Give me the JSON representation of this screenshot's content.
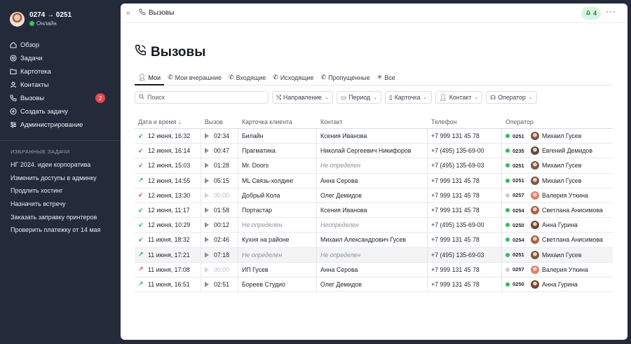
{
  "user": {
    "name": "0274 → 0251",
    "status": "Онлайн"
  },
  "nav": [
    {
      "label": "Обзор",
      "icon": "home-icon"
    },
    {
      "label": "Задачи",
      "icon": "target-icon"
    },
    {
      "label": "Картотека",
      "icon": "folder-icon"
    },
    {
      "label": "Контакты",
      "icon": "person-icon"
    },
    {
      "label": "Вызовы",
      "icon": "phone-icon",
      "badge": "2"
    },
    {
      "label": "Создать задачу",
      "icon": "plus-circle-icon"
    },
    {
      "label": "Администрирование",
      "icon": "sliders-icon"
    }
  ],
  "favorites": {
    "title": "ИЗБРАННЫЕ ЗАДАЧИ",
    "items": [
      "НГ 2024. идеи корпоратива",
      "Изменить доступы в админку",
      "Продлить хостинг",
      "Назначить встречу",
      "Заказать заправку принтеров",
      "Проверить платежку от 14 мая"
    ]
  },
  "topbar": {
    "collapse": "«",
    "title": "Вызовы",
    "notifications": "4",
    "more": "···"
  },
  "page": {
    "title": "Вызовы"
  },
  "tabs": [
    "Мои",
    "Мои вчерашние",
    "Входящие",
    "Исходящие",
    "Пропущенные",
    "Все"
  ],
  "search": {
    "placeholder": "Поиск"
  },
  "filters": [
    "Направление",
    "Период",
    "Карточка",
    "Контакт",
    "Оператор"
  ],
  "columns": [
    "Дата и время ↓",
    "Вызов",
    "Карточка клиента",
    "Контакт",
    "Телефон",
    "Оператор"
  ],
  "colors": {
    "accent": "#151a22",
    "online": "#34c759",
    "missed": "#e5484d",
    "incoming": "#2fa85a"
  },
  "rows": [
    {
      "dir": "↙",
      "type": "in",
      "date": "12 июня, 16:32",
      "dur": "02:34",
      "card": "Билайн",
      "contact": "Ксения Иванова",
      "phone": "+7 999 131 45 78",
      "op_status": "#2fbf5a",
      "ext": "0251",
      "op_color": "#7a5a48",
      "op": "Михаил Гусев"
    },
    {
      "dir": "↙",
      "type": "in",
      "date": "12 июня, 16:14",
      "dur": "00:47",
      "card": "Прагматика",
      "contact": "Николай Сергеевич Никифоров",
      "phone": "+7 (495) 135-69-00",
      "op_status": "#2fbf5a",
      "ext": "0235",
      "op_color": "#5a4a42",
      "op": "Евгений Демидов"
    },
    {
      "dir": "↙",
      "type": "in",
      "date": "12 июня, 15:03",
      "dur": "01:28",
      "card": "Mr. Doors",
      "contact": "Не определен",
      "contact_muted": true,
      "phone": "+7 (495) 135-69-03",
      "op_status": "#2fbf5a",
      "ext": "0251",
      "op_color": "#7a5a48",
      "op": "Михаил Гусев"
    },
    {
      "dir": "↗",
      "type": "out",
      "date": "12 июня, 14:55",
      "dur": "05:15",
      "card": "ML Связь-холдинг",
      "contact": "Анна Серова",
      "phone": "+7 999 131 45 78",
      "op_status": "#2fbf5a",
      "ext": "0251",
      "op_color": "#7a5a48",
      "op": "Михаил Гусев"
    },
    {
      "dir": "↙",
      "type": "missed",
      "date": "12 июня, 13:30",
      "dur": "00:00",
      "dur_muted": true,
      "card": "Добрый Кола",
      "contact": "Олег Демидов",
      "phone": "+7 999 131 45 78",
      "op_status": "#c9cdd3",
      "ext": "0257",
      "op_color": "#d9826e",
      "op": "Валерия Уткина"
    },
    {
      "dir": "↙",
      "type": "in",
      "date": "12 июня, 11:17",
      "dur": "01:58",
      "card": "Портастар",
      "contact": "Ксения Иванова",
      "phone": "+7 999 131 45 78",
      "op_status": "#2fbf5a",
      "ext": "0254",
      "op_color": "#a7614c",
      "op": "Светлана Анисимова"
    },
    {
      "dir": "↙",
      "type": "in",
      "date": "12 июня, 10:29",
      "dur": "00:12",
      "card": "Не определен",
      "card_muted": true,
      "contact": "Неопределен",
      "contact_muted": true,
      "phone": "+7 (495) 135-69-00",
      "op_status": "#2fbf5a",
      "ext": "0250",
      "op_color": "#6a4636",
      "op": "Анна Гурина"
    },
    {
      "dir": "↙",
      "type": "in",
      "date": "11 июня, 18:32",
      "dur": "02:46",
      "card": "Кухня на районе",
      "contact": "Михаил Александрович Гусев",
      "phone": "+7 999 131 45 78",
      "op_status": "#2fbf5a",
      "ext": "0254",
      "op_color": "#a7614c",
      "op": "Светлана Анисимова"
    },
    {
      "dir": "↗",
      "type": "out",
      "date": "11 июня, 17:21",
      "dur": "07:18",
      "card": "Не определен",
      "card_muted": true,
      "contact": "Не определен",
      "contact_muted": true,
      "phone": "+7 (495) 135-69-03",
      "op_status": "#2fbf5a",
      "ext": "0251",
      "op_color": "#7a5a48",
      "op": "Михаил Гусев",
      "highlight": true
    },
    {
      "dir": "↗",
      "type": "missed",
      "date": "11 июня, 17:08",
      "dur": "00:00",
      "dur_muted": true,
      "card": "ИП Гусев",
      "contact": "Анна Серова",
      "phone": "+7 999 131 45 78",
      "op_status": "#c9cdd3",
      "ext": "0257",
      "op_color": "#d9826e",
      "op": "Валерия Уткина"
    },
    {
      "dir": "↗",
      "type": "out",
      "date": "11 июня, 16:51",
      "dur": "02:51",
      "card": "Бореев Студио",
      "contact": "Олег Демидов",
      "phone": "+7 999 131 45 78",
      "op_status": "#2fbf5a",
      "ext": "0250",
      "op_color": "#6a4636",
      "op": "Анна Гурина"
    }
  ]
}
